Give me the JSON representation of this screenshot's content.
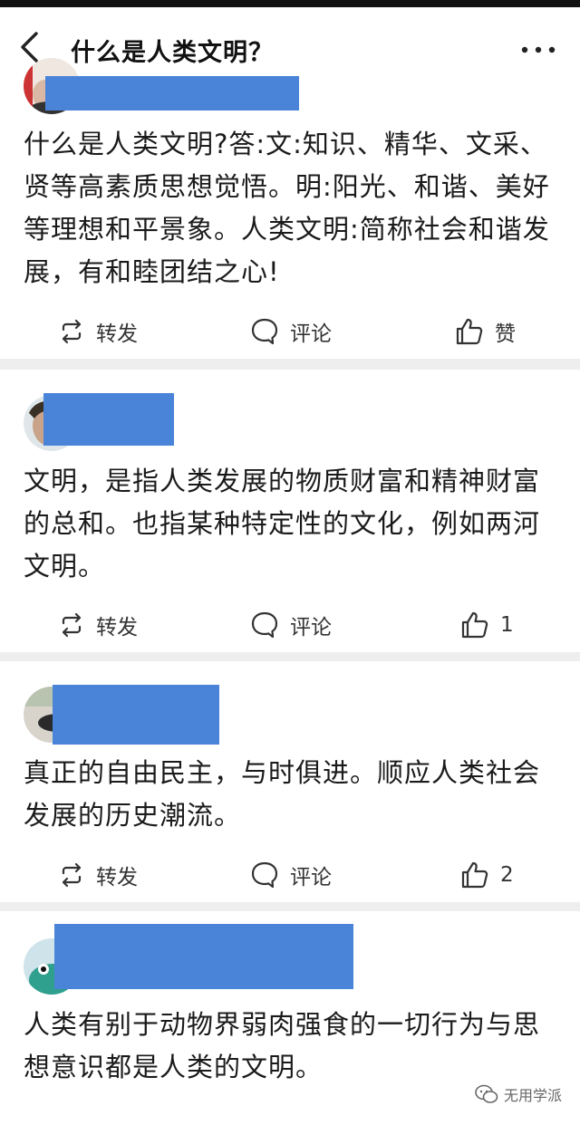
{
  "header": {
    "title": "什么是人类文明？",
    "back_icon": "chevron-left-icon",
    "more_icon": "more-dots-icon"
  },
  "posts": [
    {
      "content": "什么是人类文明?答:文:知识、精华、文采、贤等高素质思想觉悟。明:阳光、和谐、美好等理想和平景象。人类文明:简称社会和谐发展，有和睦团结之心!",
      "repost_label": "转发",
      "comment_label": "评论",
      "like_label": "赞"
    },
    {
      "content": "文明，是指人类发展的物质财富和精神财富的总和。也指某种特定性的文化，例如两河文明。",
      "repost_label": "转发",
      "comment_label": "评论",
      "like_label": "1"
    },
    {
      "content": "真正的自由民主，与时俱进。顺应人类社会发展的历史潮流。",
      "repost_label": "转发",
      "comment_label": "评论",
      "like_label": "2"
    },
    {
      "content": "人类有别于动物界弱肉强食的一切行为与思想意识都是人类的文明。"
    }
  ],
  "watermark": {
    "text": "无用学派"
  },
  "colors": {
    "name_mask": "#4a84d8",
    "background": "#eeeeef"
  }
}
